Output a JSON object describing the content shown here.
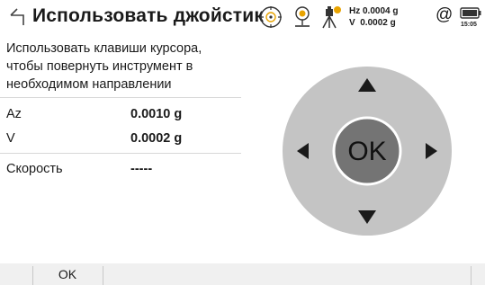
{
  "header": {
    "title": "Использовать джойстик",
    "hz_label": "Hz 0.0004 g",
    "v_label": "V  0.0002 g",
    "at_symbol": "@",
    "time": "15:05"
  },
  "info": {
    "description": "Использовать клавиши курсора, чтобы повернуть инструмент в необходимом направлении",
    "rows": [
      {
        "label": "Az",
        "value": "0.0010 g"
      },
      {
        "label": "V",
        "value": "0.0002 g"
      },
      {
        "label": "Скорость",
        "value": "-----"
      }
    ]
  },
  "joystick": {
    "center_label": "OK",
    "ring_color": "#c4c4c4",
    "center_color": "#747474",
    "arrow_color": "#1a1a1a"
  },
  "footer": {
    "ok_label": "OK"
  }
}
